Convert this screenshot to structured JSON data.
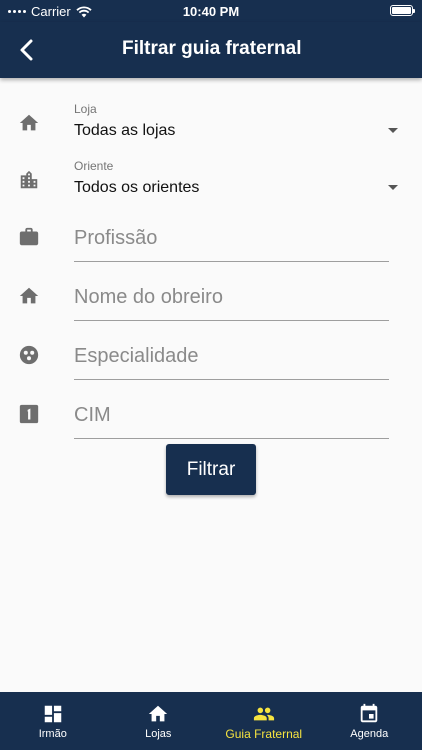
{
  "status_bar": {
    "carrier": "Carrier",
    "time": "10:40 PM"
  },
  "header": {
    "title": "Filtrar guia fraternal"
  },
  "filters": {
    "loja": {
      "label": "Loja",
      "value": "Todas as lojas"
    },
    "oriente": {
      "label": "Oriente",
      "value": "Todos os orientes"
    },
    "profissao": {
      "placeholder": "Profissão"
    },
    "nome": {
      "placeholder": "Nome do obreiro"
    },
    "especialidade": {
      "placeholder": "Especialidade"
    },
    "cim": {
      "placeholder": "CIM"
    }
  },
  "submit_label": "Filtrar",
  "bottom_nav": {
    "items": [
      {
        "label": "Irmão",
        "icon": "dashboard-icon"
      },
      {
        "label": "Lojas",
        "icon": "home-icon"
      },
      {
        "label": "Guia Fraternal",
        "icon": "people-icon",
        "active": true
      },
      {
        "label": "Agenda",
        "icon": "calendar-icon"
      }
    ]
  },
  "colors": {
    "primary": "#172f4f",
    "active_nav": "#f6e440",
    "icon_gray": "#6e6e6e"
  }
}
